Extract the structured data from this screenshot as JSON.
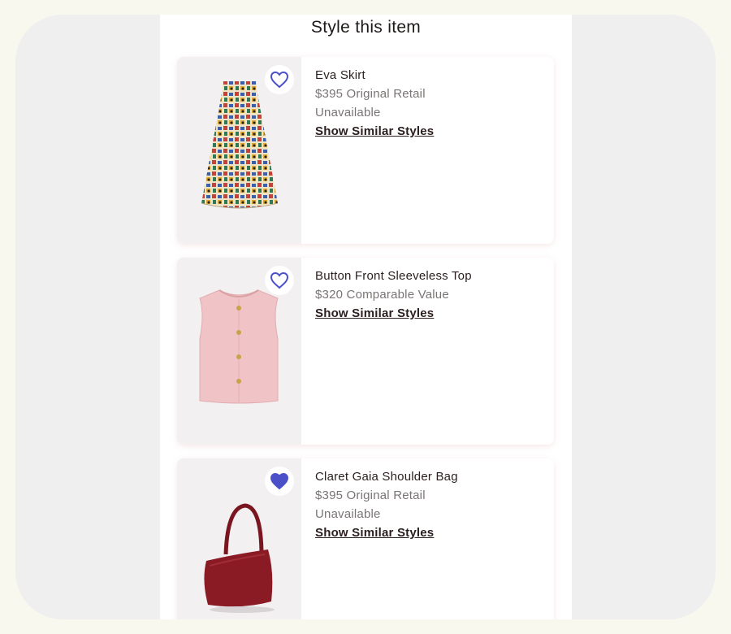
{
  "page": {
    "title": "Style this item"
  },
  "colors": {
    "accent": "#4b50c8",
    "heart_fill": "#4b50c8"
  },
  "items": [
    {
      "name": "Eva Skirt",
      "price": "$395 Original Retail",
      "status": "Unavailable",
      "link": "Show Similar Styles",
      "favorited": false,
      "image": "printed-midi-skirt"
    },
    {
      "name": "Button Front Sleeveless Top",
      "price": "$320 Comparable Value",
      "status": "",
      "link": "Show Similar Styles",
      "favorited": false,
      "image": "pink-sleeveless-top"
    },
    {
      "name": "Claret Gaia Shoulder Bag",
      "price": "$395 Original Retail",
      "status": "Unavailable",
      "link": "Show Similar Styles",
      "favorited": true,
      "image": "claret-shoulder-bag"
    }
  ]
}
